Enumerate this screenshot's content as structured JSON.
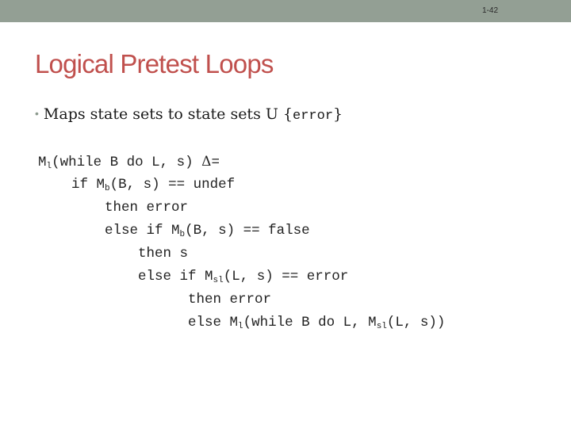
{
  "slide": {
    "number": "1-42",
    "title": "Logical Pretest Loops",
    "bullet": {
      "text": "Maps state sets to state sets U ",
      "brace_open": "{",
      "error_word": "error",
      "brace_close": "}"
    },
    "code_lines": [
      {
        "indent": "",
        "parts": [
          {
            "t": "M"
          },
          {
            "sub": "l"
          },
          {
            "t": "(while B do L, s) "
          },
          {
            "delta": "Δ"
          },
          {
            "t": "="
          }
        ]
      },
      {
        "indent": "    ",
        "parts": [
          {
            "t": "if M"
          },
          {
            "sub": "b"
          },
          {
            "t": "(B, s) == undef"
          }
        ]
      },
      {
        "indent": "        ",
        "parts": [
          {
            "t": "then error"
          }
        ]
      },
      {
        "indent": "        ",
        "parts": [
          {
            "t": "else if M"
          },
          {
            "sub": "b"
          },
          {
            "t": "(B, s) == false"
          }
        ]
      },
      {
        "indent": "            ",
        "parts": [
          {
            "t": "then s"
          }
        ]
      },
      {
        "indent": "            ",
        "parts": [
          {
            "t": "else if M"
          },
          {
            "sub": "sl"
          },
          {
            "t": "(L, s) == error"
          }
        ]
      },
      {
        "indent": "                  ",
        "parts": [
          {
            "t": "then error"
          }
        ]
      },
      {
        "indent": "                  ",
        "parts": [
          {
            "t": "else M"
          },
          {
            "sub": "l"
          },
          {
            "t": "(while B do L, M"
          },
          {
            "sub": "sl"
          },
          {
            "t": "(L, s))"
          }
        ]
      }
    ]
  },
  "colors": {
    "title": "#c0504d",
    "topbar": "#939f94"
  }
}
